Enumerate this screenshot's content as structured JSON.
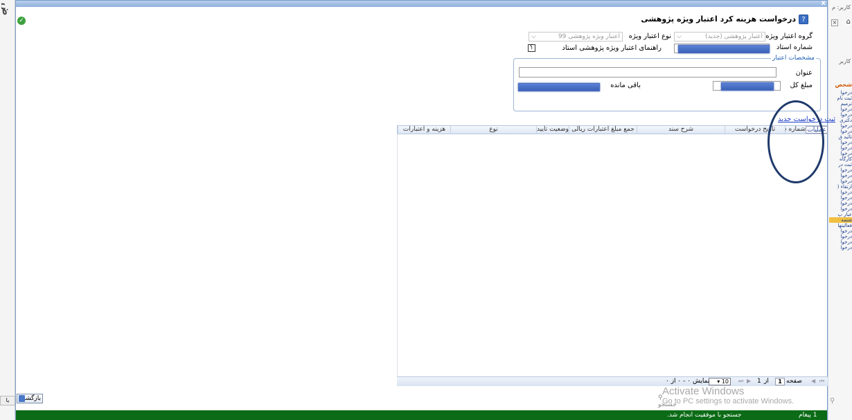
{
  "background": {
    "logo_text": "ض",
    "user_label": "کاربر: م",
    "user_label2": "کاربر",
    "section_label": "شخص",
    "menu_items": [
      "درخوا",
      "ثبت نام",
      "ترمیم",
      "درخوا",
      "درخوا",
      "دکتری",
      "درخوا",
      "درخوا",
      "تائید ق",
      "درخوا",
      "درخوا",
      "درخوا",
      "کارگاه",
      "ثبت در",
      "درخوا",
      "درخوا",
      "درخوا",
      "ارتقاء (",
      "درخوا",
      "درخوا",
      "درخوا",
      "درخوا",
      "عیار پ",
      "شتمه",
      "فعالیتها",
      "درخوا",
      "درخوا",
      "درخوا",
      "درخوا"
    ],
    "back_label": "با"
  },
  "modal": {
    "close_label": "x",
    "title": "درخواست هزینه کرد اعتبار ویژه پژوهشی",
    "form": {
      "credit_group_label": "گروه اعتبار ویژه",
      "credit_group_value": "اعتبار پژوهشی (جدید)",
      "credit_type_label": "نوع اعتبار ویژه",
      "credit_type_value": "اعتبار ویژه پژوهشی 99",
      "professor_number_label": "شماره استاد",
      "guide_label": "راهنمای اعتبار ویژه پژوهشی استاد",
      "guide_button": "؟"
    },
    "credit_specs": {
      "legend": "مشخصات اعتبار",
      "title_label": "عنوان",
      "total_amount_label": "مبلغ کل",
      "remaining_label": "باقی مانده"
    },
    "new_request_link": "ثبت درخواست جدید",
    "grid": {
      "columns": [
        "عملیات",
        "شماره سند",
        "تاریخ درخواست",
        "شرح سند",
        "جمع مبلغ اعتبارات ریالی",
        "وضعیت تایید",
        "نوع",
        "هزینه و اعتبارات"
      ],
      "rows": []
    },
    "pager": {
      "page_label": "صفحه",
      "page_value": "1",
      "of_label": "از",
      "of_value": "1",
      "page_size": "10",
      "display_text": "نمایش ۰ - ۰ از ۰"
    },
    "back_button": "بازگشت",
    "status": {
      "message": "جستجو با موفقیت انجام شد.",
      "count": "1 پیغام"
    }
  },
  "windows_watermark": {
    "line1": "Activate Windows",
    "line2": "Go to PC settings to activate Windows."
  },
  "search_button": "جستجو",
  "colors": {
    "status_bar": "#0b6b16",
    "header_gradient": "#8fb1dc",
    "mask": "#3c62b8",
    "annotation_circle": "#1f3a6b"
  }
}
